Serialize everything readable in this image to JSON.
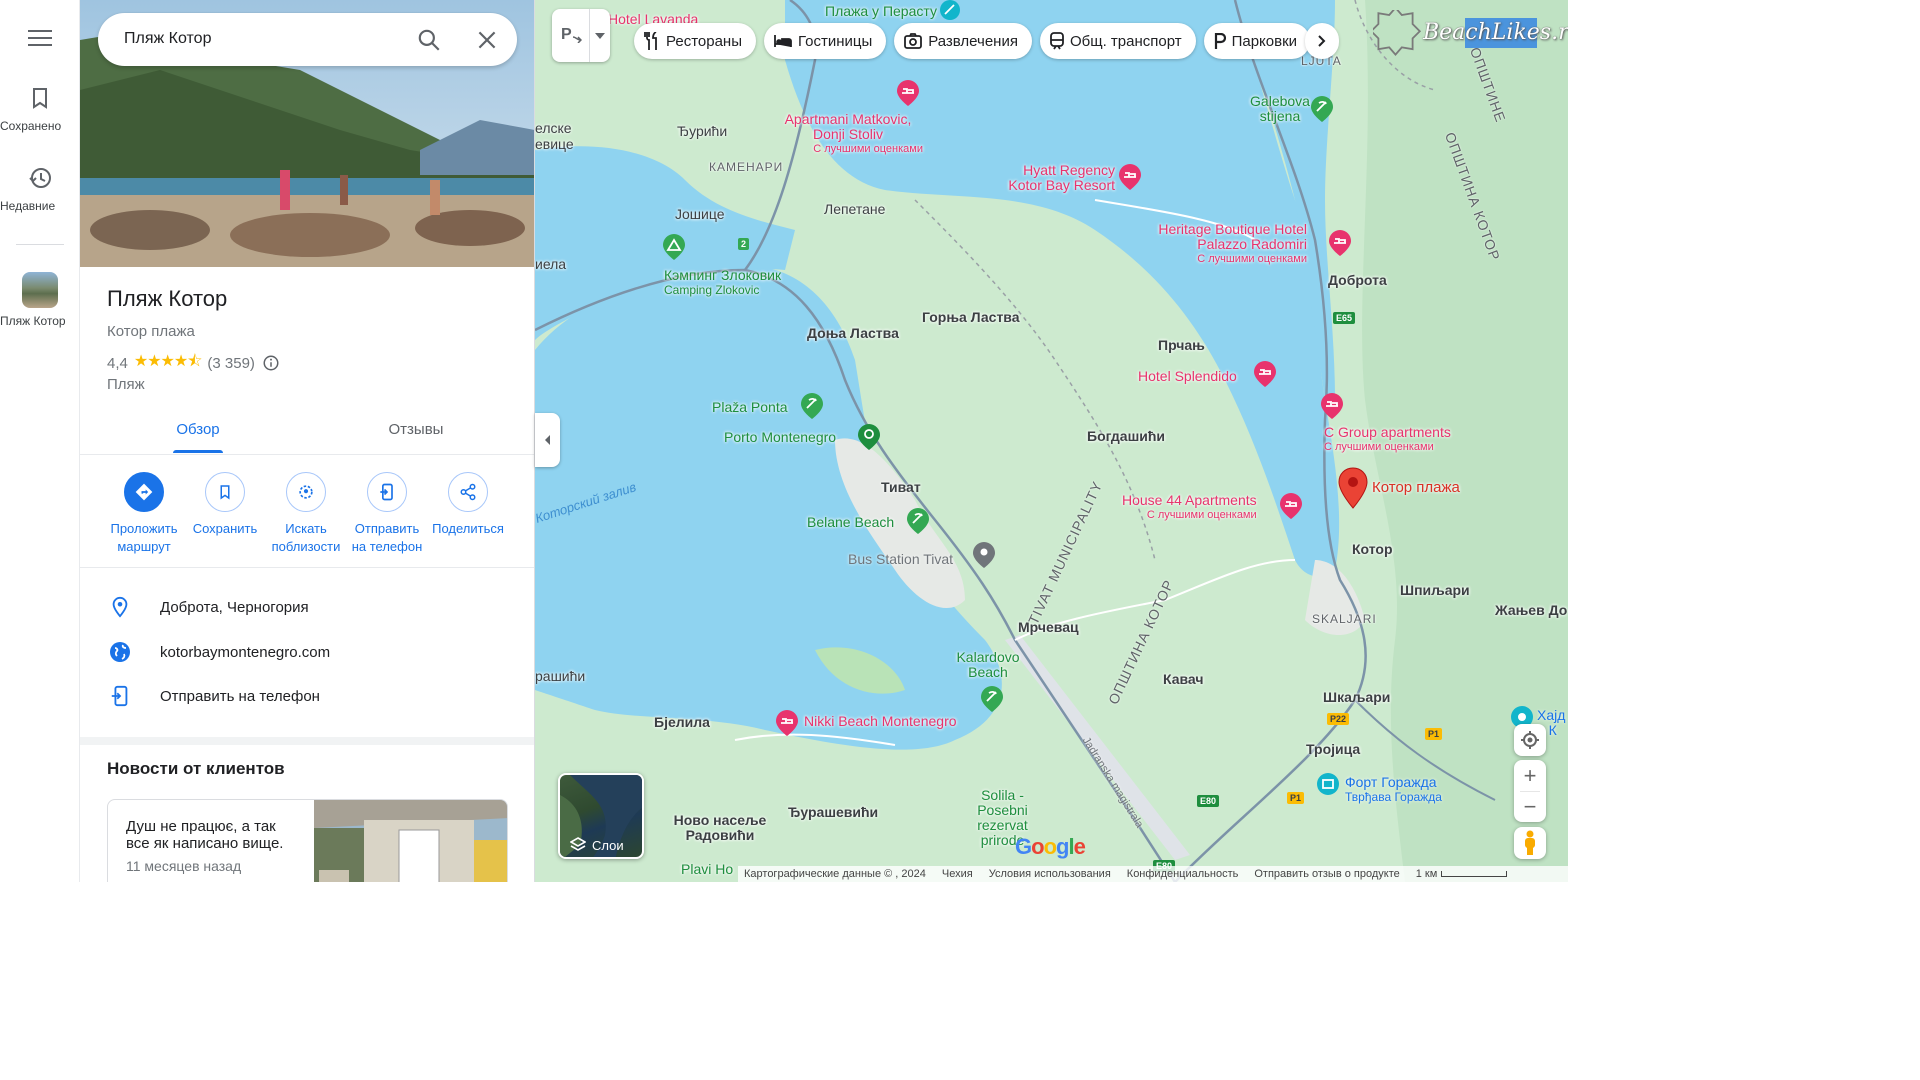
{
  "rail": {
    "saved_label": "Сохранено",
    "recent_label": "Недавние",
    "recent_place_label": "Пляж Котор"
  },
  "search": {
    "value": "Пляж Котор"
  },
  "place": {
    "title": "Пляж Котор",
    "subtitle": "Котор плажа",
    "rating": "4,4",
    "stars": "★★★★⯪",
    "reviews_count": "(3 359)",
    "category": "Пляж"
  },
  "tabs": [
    {
      "label": "Обзор",
      "active": true
    },
    {
      "label": "Отзывы",
      "active": false
    }
  ],
  "actions": [
    {
      "label": "Проложить маршрут",
      "icon": "directions-icon"
    },
    {
      "label": "Сохранить",
      "icon": "bookmark-icon"
    },
    {
      "label": "Искать поблизости",
      "icon": "nearby-icon"
    },
    {
      "label": "Отправить на телефон",
      "icon": "send-to-phone-icon"
    },
    {
      "label": "Поделиться",
      "icon": "share-icon"
    }
  ],
  "info": {
    "address": "Доброта, Черногория",
    "website": "kotorbaymontenegro.com",
    "send_to_phone": "Отправить на телефон"
  },
  "news": {
    "heading": "Новости от клиентов",
    "card_text": "Душ не працює, а так все як написано вище.",
    "card_time": "11 месяцев назад"
  },
  "chips": [
    {
      "label": "Рестораны",
      "icon": "fork-knife-icon"
    },
    {
      "label": "Гостиницы",
      "icon": "bed-icon"
    },
    {
      "label": "Развлечения",
      "icon": "camera-icon"
    },
    {
      "label": "Общ. транспорт",
      "icon": "train-icon"
    },
    {
      "label": "Парковки",
      "icon": "parking-icon"
    }
  ],
  "route_button_label": "Р",
  "watermark": "BeachLikes.ru",
  "map": {
    "towns": [
      "Ђурићи",
      "КАМЕНАРИ",
      "Јошице",
      "Лепетане",
      "Доња Ластва",
      "Горња Ластва",
      "Прчањ",
      "Богдашићи",
      "Доброта",
      "Тиват",
      "Котор",
      "Шпиљари",
      "Жањев До",
      "SKALJARI",
      "Мрчевац",
      "Кавач",
      "Шкаљари",
      "Тројица",
      "Бјелила",
      "Ђурашевићи",
      "Ново насеље Радовићи",
      "LJUTA",
      "елске евице",
      "иела",
      "рашићи"
    ],
    "pois_hotel": [
      {
        "name": "Hotel Lavanda",
        "sub": ""
      },
      {
        "name": "Apartmani Matkovic, Donji Stoliv",
        "sub": "С лучшими оценками"
      },
      {
        "name": "Hyatt Regency Kotor Bay Resort",
        "sub": ""
      },
      {
        "name": "Heritage Boutique Hotel Palazzo Radomiri",
        "sub": "С лучшими оценками"
      },
      {
        "name": "Hotel Splendido",
        "sub": ""
      },
      {
        "name": "C Group apartments",
        "sub": "С лучшими оценками"
      },
      {
        "name": "House 44 Apartments",
        "sub": "С лучшими оценками"
      },
      {
        "name": "Nikki Beach Montenegro",
        "sub": ""
      }
    ],
    "pois_green": [
      {
        "name": "Плажа у Перасту",
        "sub": ""
      },
      {
        "name": "Galebova stijena",
        "sub": ""
      },
      {
        "name": "Кэмпинг Злоковик",
        "sub": "Camping Zlokovic"
      },
      {
        "name": "Plaža Ponta",
        "sub": ""
      },
      {
        "name": "Porto Montenegro",
        "sub": ""
      },
      {
        "name": "Belane Beach",
        "sub": ""
      },
      {
        "name": "Kalardovo Beach",
        "sub": ""
      },
      {
        "name": "Solila - Posebni rezervat prirode",
        "sub": ""
      }
    ],
    "bus_station": "Bus Station Tivat",
    "fort": {
      "name": "Форт Горажда",
      "sub": "Тврђава Горажда"
    },
    "hajd": "Хајд а К",
    "plavi": "Plavi Ho",
    "selected_pin": "Котор плажа",
    "water_label": "Которский залив",
    "muni_1": "TIVAT MUNICIPALITY",
    "muni_2": "ОПШТИНА КОТОР",
    "muni_3": "ОПШТИНА КОТОР",
    "muni_4": "ОПШТИНЕ",
    "road": "Jadranska magistrala",
    "shields": [
      "2",
      "E65",
      "P22",
      "P1",
      "P1",
      "E80",
      "E80"
    ]
  },
  "layers_label": "Слои",
  "footer": {
    "copyright": "Картографические данные © , 2024",
    "country": "Чехия",
    "terms": "Условия использования",
    "privacy": "Конфиденциальность",
    "feedback": "Отправить отзыв о продукте",
    "scale": "1 км"
  },
  "colors": {
    "accent": "#1a73e8",
    "water": "#8fd3f0",
    "land": "#cdeacf",
    "hotel_pin": "#e8336d",
    "green_pin": "#34a853",
    "selected_pin": "#ea4335"
  }
}
